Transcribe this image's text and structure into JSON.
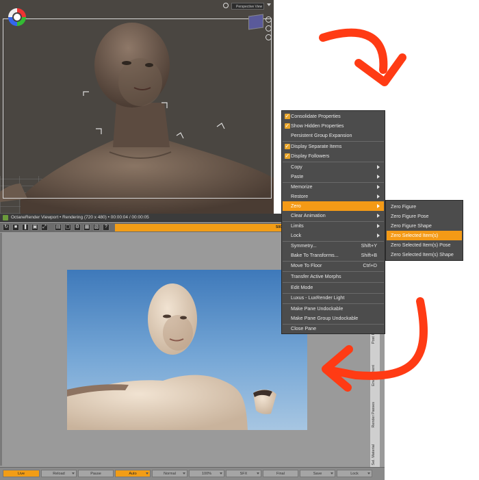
{
  "viewport3d": {
    "view_label": "Perspective View"
  },
  "octane": {
    "title": "OctaneRender Viewport • Rendering (720 x 480) • 00:00:04 / 00:00:05",
    "status": "500/500 s/pix • 37.69 Ms/sec • 363/5394 MB • 1 GPU • 72 °C",
    "side_tabs": [
      "Post Pro",
      "Environment",
      "Render Passes",
      "Sel. Material"
    ],
    "bottom_bar": [
      "Live",
      "Reload",
      "Pause",
      "Auto",
      "Normal",
      "100%",
      "SFX",
      "Final",
      "Save",
      "Lock"
    ]
  },
  "context_menu": {
    "items": [
      {
        "label": "Consolidate Properties",
        "checked": true
      },
      {
        "label": "Show Hidden Properties",
        "checked": true
      },
      {
        "label": "Persistent Group Expansion",
        "checked": false
      },
      {
        "label": "Display Separate Items",
        "checked": true
      },
      {
        "label": "Display Followers",
        "checked": true
      },
      {
        "label": "Copy",
        "submenu": true
      },
      {
        "label": "Paste",
        "submenu": true
      },
      {
        "label": "Memorize",
        "submenu": true
      },
      {
        "label": "Restore",
        "submenu": true
      },
      {
        "label": "Zero",
        "submenu": true,
        "highlighted": true
      },
      {
        "label": "Clear Animation",
        "submenu": true
      },
      {
        "label": "Limits",
        "submenu": true
      },
      {
        "label": "Lock",
        "submenu": true
      },
      {
        "label": "Symmetry...",
        "shortcut": "Shift+Y"
      },
      {
        "label": "Bake To Transforms...",
        "shortcut": "Shift+B"
      },
      {
        "label": "Move To Floor",
        "shortcut": "Ctrl+D"
      },
      {
        "label": "Transfer Active Morphs"
      },
      {
        "label": "Edit Mode"
      },
      {
        "label": "Luxus - LuxRender Light"
      },
      {
        "label": "Make Pane Undockable"
      },
      {
        "label": "Make Pane Group Undockable"
      },
      {
        "label": "Close Pane"
      }
    ]
  },
  "zero_submenu": {
    "items": [
      {
        "label": "Zero Figure"
      },
      {
        "label": "Zero Figure Pose"
      },
      {
        "label": "Zero Figure Shape"
      },
      {
        "label": "Zero Selected Item(s)",
        "highlighted": true
      },
      {
        "label": "Zero Selected Item(s) Pose"
      },
      {
        "label": "Zero Selected Item(s) Shape"
      }
    ]
  },
  "colors": {
    "accent": "#f49a16",
    "menu_bg": "#4c4c4c",
    "annotation_arrow": "#ff3b14"
  }
}
